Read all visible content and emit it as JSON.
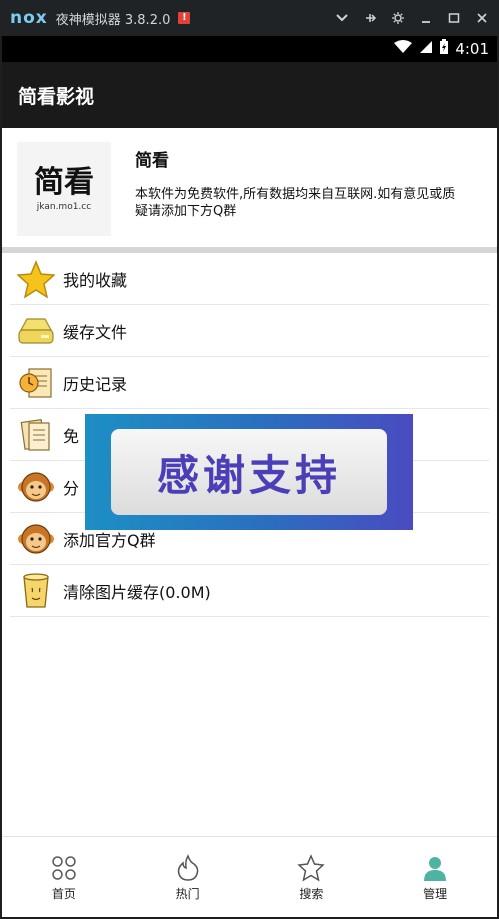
{
  "emulator": {
    "logo": "nox",
    "title": "夜神模拟器 3.8.2.0",
    "alert": "!"
  },
  "status_bar": {
    "time": "4:01"
  },
  "app_bar": {
    "title": "简看影视"
  },
  "about": {
    "logo_text": "简看",
    "logo_url": "jkan.mo1.cc",
    "title": "简看",
    "description": "本软件为免费软件,所有数据均来自互联网.如有意见或质疑请添加下方Q群"
  },
  "menu": {
    "items": [
      {
        "label": "我的收藏",
        "icon": "star-icon"
      },
      {
        "label": "缓存文件",
        "icon": "disk-icon"
      },
      {
        "label": "历史记录",
        "icon": "history-icon"
      },
      {
        "label": "免",
        "icon": "document-icon"
      },
      {
        "label": "分",
        "icon": "monkey-icon"
      },
      {
        "label": "添加官方Q群",
        "icon": "monkey-icon"
      },
      {
        "label": "清除图片缓存(0.0M)",
        "icon": "trash-icon"
      }
    ]
  },
  "toast": {
    "text": "感谢支持"
  },
  "bottom_nav": {
    "items": [
      {
        "label": "首页",
        "icon": "home-icon"
      },
      {
        "label": "热门",
        "icon": "fire-icon"
      },
      {
        "label": "搜索",
        "icon": "star-outline-icon"
      },
      {
        "label": "管理",
        "icon": "user-icon"
      }
    ],
    "active_color": "#4fb3a1"
  }
}
